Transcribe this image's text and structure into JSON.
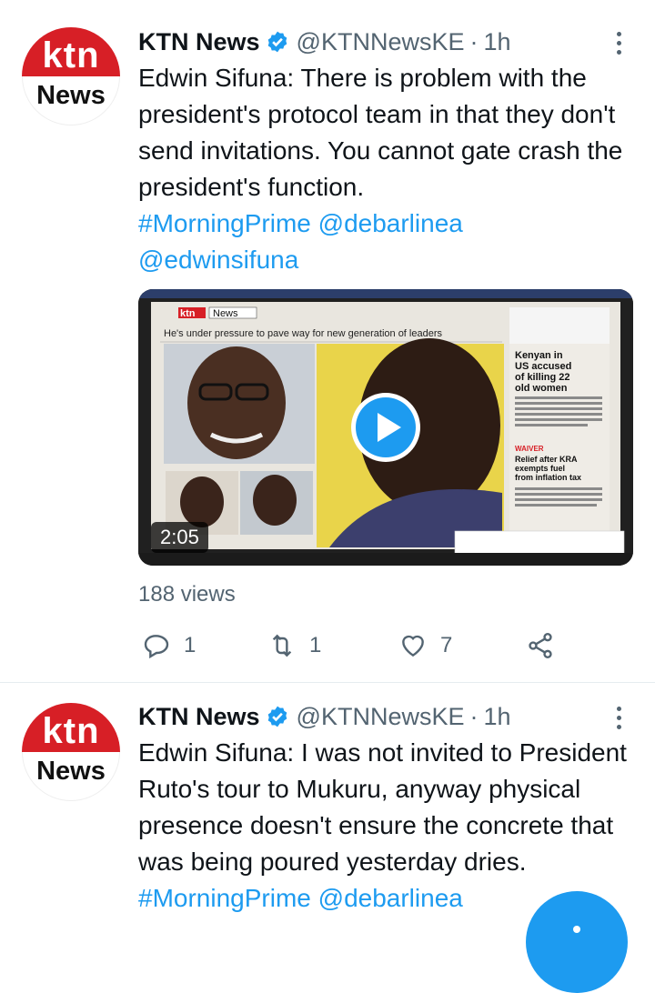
{
  "tweets": [
    {
      "avatar": {
        "line1": "ktn",
        "line2": "News"
      },
      "author_name": "KTN News",
      "handle": "@KTNNewsKE",
      "separator": "·",
      "time": "1h",
      "text": "Edwin Sifuna: There is problem with the president's protocol team in that they don't send invitations. You cannot gate crash the president's function.",
      "hashtag": "#MorningPrime",
      "mention1": "@debarlinea",
      "mention2": "@edwinsifuna",
      "media": {
        "duration": "2:05",
        "brand_ktn": "ktn",
        "brand_news": "News",
        "headline": "He's under pressure to pave way for new generation of leaders",
        "side_headline": "Kenyan in US accused of killing 22 old women",
        "relief_headline": "Relief after KRA exempts fuel from inflation tax",
        "waiver": "WAIVER"
      },
      "views": "188 views",
      "replies": "1",
      "retweets": "1",
      "likes": "7"
    },
    {
      "avatar": {
        "line1": "ktn",
        "line2": "News"
      },
      "author_name": "KTN News",
      "handle": "@KTNNewsKE",
      "separator": "·",
      "time": "1h",
      "text": "Edwin Sifuna: I was not invited to President Ruto's tour to Mukuru, anyway physical presence doesn't ensure the concrete that was being poured yesterday dries.",
      "hashtag": "#MorningPrime",
      "mention1": "@debarlinea"
    }
  ],
  "colors": {
    "accent": "#1d9bf0",
    "text": "#0f1419",
    "muted": "#536471",
    "brand_red": "#d71f26"
  },
  "icons": [
    "verified-badge-icon",
    "more-options-icon",
    "reply-icon",
    "retweet-icon",
    "like-icon",
    "share-icon",
    "play-icon",
    "compose-icon"
  ]
}
